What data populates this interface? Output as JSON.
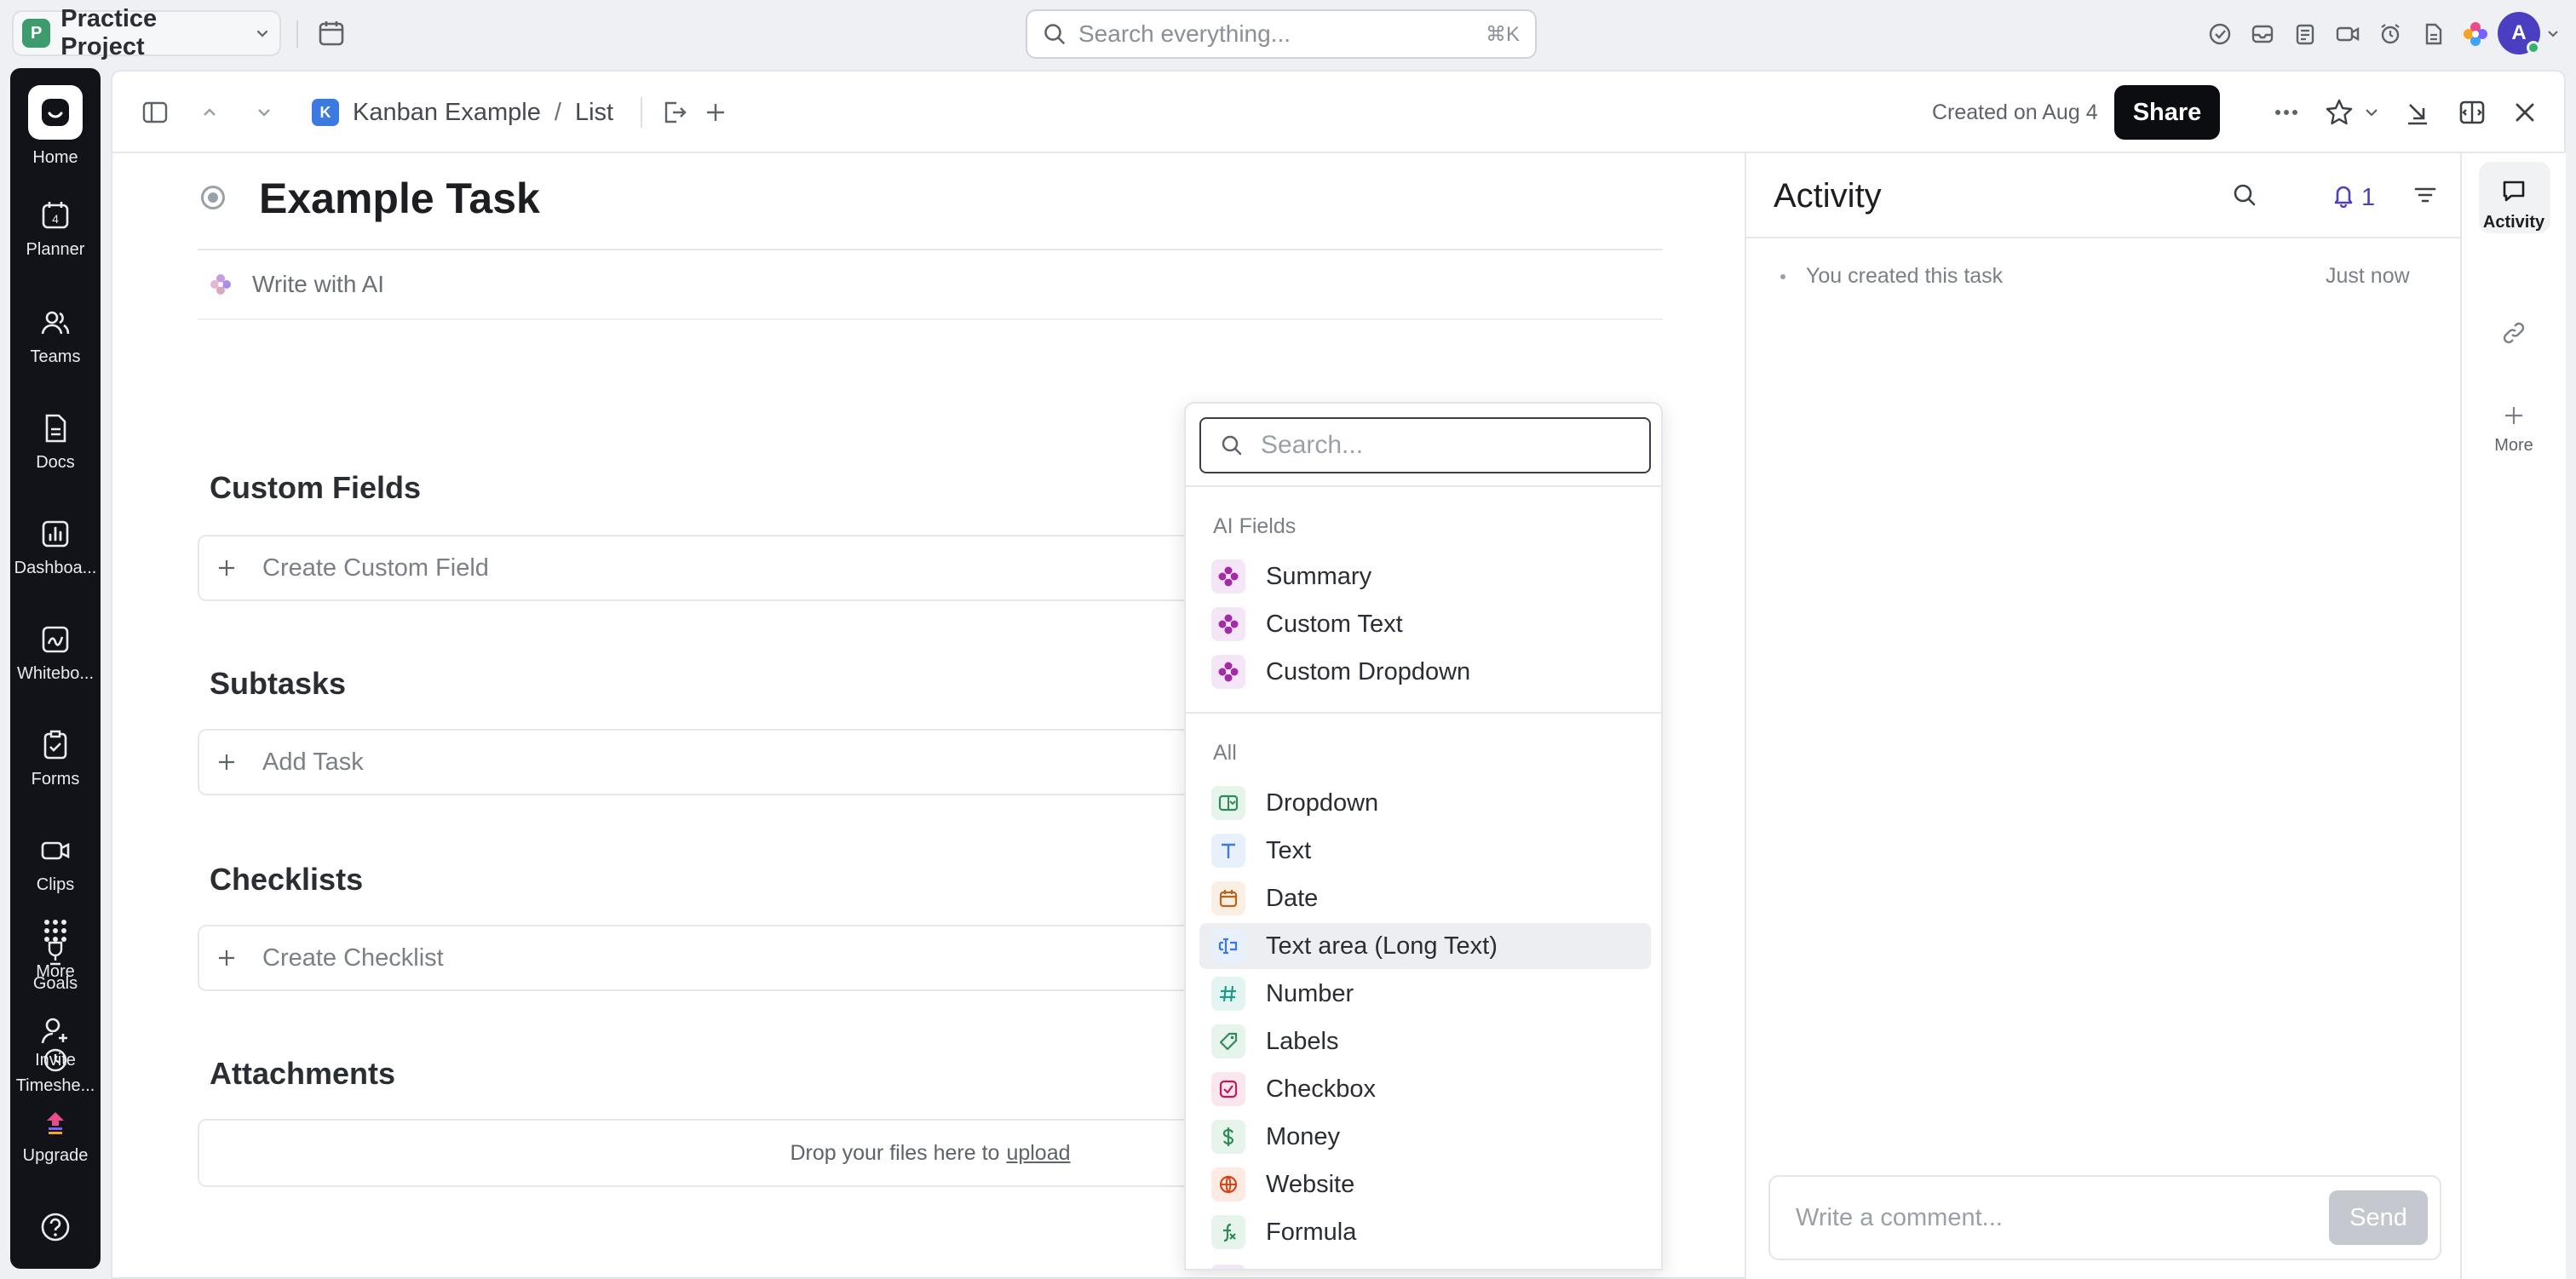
{
  "topbar": {
    "workspace_initial": "P",
    "workspace_name": "Practice Project",
    "search_placeholder": "Search everything...",
    "search_shortcut": "⌘K",
    "user_initial": "A"
  },
  "rail": {
    "items": [
      {
        "label": "Home",
        "icon": "home-icon"
      },
      {
        "label": "Planner",
        "icon": "calendar-icon",
        "badge": "4"
      },
      {
        "label": "Teams",
        "icon": "team-icon"
      },
      {
        "label": "Docs",
        "icon": "doc-icon"
      },
      {
        "label": "Dashboa...",
        "icon": "chart-icon"
      },
      {
        "label": "Whitebo...",
        "icon": "whiteboard-icon"
      },
      {
        "label": "Forms",
        "icon": "form-icon"
      },
      {
        "label": "Clips",
        "icon": "video-icon"
      },
      {
        "label": "More",
        "icon": "grid-dots-icon"
      },
      {
        "label": "Goals",
        "icon": "trophy-icon"
      },
      {
        "label": "Invite",
        "icon": "add-user-icon"
      },
      {
        "label": "Timeshe...",
        "icon": "clock-icon"
      },
      {
        "label": "Upgrade",
        "icon": "upgrade-icon"
      }
    ]
  },
  "toolbar": {
    "breadcrumb_badge": "K",
    "breadcrumb": [
      "Kanban Example",
      "/",
      "List"
    ],
    "created": "Created on Aug 4",
    "share_label": "Share"
  },
  "task": {
    "title": "Example Task",
    "write_ai": "Write with AI",
    "sections": {
      "custom_fields": {
        "title": "Custom Fields",
        "action": "Create Custom Field"
      },
      "subtasks": {
        "title": "Subtasks",
        "action": "Add Task"
      },
      "checklists": {
        "title": "Checklists",
        "action": "Create Checklist"
      },
      "attachments": {
        "title": "Attachments",
        "drop_text": "Drop your files here to",
        "upload": "upload"
      }
    }
  },
  "popover": {
    "search_placeholder": "Search...",
    "ai_group": "AI Fields",
    "ai_items": [
      "Summary",
      "Custom Text",
      "Custom Dropdown"
    ],
    "all_group": "All",
    "all_items": [
      {
        "label": "Dropdown",
        "icon": "dropdown-field-icon",
        "color": "#2e8b57",
        "bg": "#e6f4ec"
      },
      {
        "label": "Text",
        "icon": "text-field-icon",
        "color": "#3b7ae0",
        "bg": "#e8f0fc"
      },
      {
        "label": "Date",
        "icon": "date-field-icon",
        "color": "#b5651d",
        "bg": "#fbeee2"
      },
      {
        "label": "Text area (Long Text)",
        "icon": "textarea-field-icon",
        "color": "#3b7ae0",
        "bg": "#e8f0fc"
      },
      {
        "label": "Number",
        "icon": "number-field-icon",
        "color": "#1f9a8a",
        "bg": "#e3f5f2"
      },
      {
        "label": "Labels",
        "icon": "label-field-icon",
        "color": "#2e8b57",
        "bg": "#e6f4ec"
      },
      {
        "label": "Checkbox",
        "icon": "checkbox-field-icon",
        "color": "#c2185b",
        "bg": "#fbe6ee"
      },
      {
        "label": "Money",
        "icon": "money-field-icon",
        "color": "#2e8b57",
        "bg": "#e6f4ec"
      },
      {
        "label": "Website",
        "icon": "website-field-icon",
        "color": "#d84315",
        "bg": "#fdeae3"
      },
      {
        "label": "Formula",
        "icon": "formula-field-icon",
        "color": "#2e8b57",
        "bg": "#e6f4ec"
      }
    ],
    "highlighted": "Text area (Long Text)"
  },
  "activity": {
    "title": "Activity",
    "notify_count": "1",
    "entry": "You created this task",
    "entry_time": "Just now",
    "comment_placeholder": "Write a comment...",
    "send_label": "Send"
  },
  "right_rail": {
    "items": [
      {
        "label": "Activity",
        "icon": "comment-icon"
      },
      {
        "label": "",
        "icon": "link-icon"
      },
      {
        "label": "More",
        "icon": "plus-icon"
      }
    ]
  },
  "colors": {
    "accent": "#4b3fc1",
    "rail_bg": "#111318",
    "workspace": "#3e9b6d",
    "breadcrumb_badge": "#3b7ae0"
  }
}
